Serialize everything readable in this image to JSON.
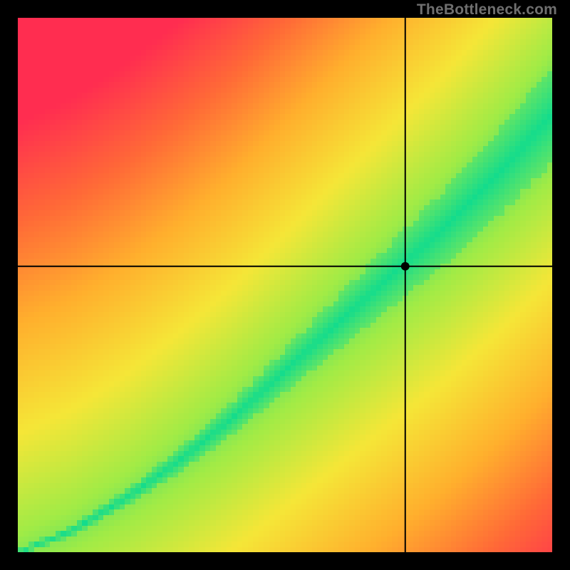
{
  "watermark": "TheBottleneck.com",
  "chart_data": {
    "type": "heatmap",
    "title": "",
    "xlabel": "",
    "ylabel": "",
    "xlim": [
      0,
      100
    ],
    "ylim": [
      0,
      100
    ],
    "crosshair": {
      "x": 72.5,
      "y": 53.5
    },
    "marker": {
      "x": 72.5,
      "y": 53.5
    },
    "ridge_points": [
      {
        "x": 0,
        "y": 0
      },
      {
        "x": 10,
        "y": 4
      },
      {
        "x": 20,
        "y": 10
      },
      {
        "x": 30,
        "y": 17
      },
      {
        "x": 40,
        "y": 25
      },
      {
        "x": 50,
        "y": 34
      },
      {
        "x": 60,
        "y": 43
      },
      {
        "x": 70,
        "y": 52
      },
      {
        "x": 80,
        "y": 61
      },
      {
        "x": 90,
        "y": 71
      },
      {
        "x": 100,
        "y": 82
      }
    ],
    "ridge_halfwidth_points": [
      {
        "x": 0,
        "half": 0.5
      },
      {
        "x": 20,
        "half": 1.5
      },
      {
        "x": 40,
        "half": 3
      },
      {
        "x": 60,
        "half": 5
      },
      {
        "x": 80,
        "half": 7
      },
      {
        "x": 100,
        "half": 9
      }
    ],
    "colorscale_description": "green (best match along diagonal ridge) through yellow/orange to red (worst match in corners)",
    "grid": false,
    "legend": false
  }
}
